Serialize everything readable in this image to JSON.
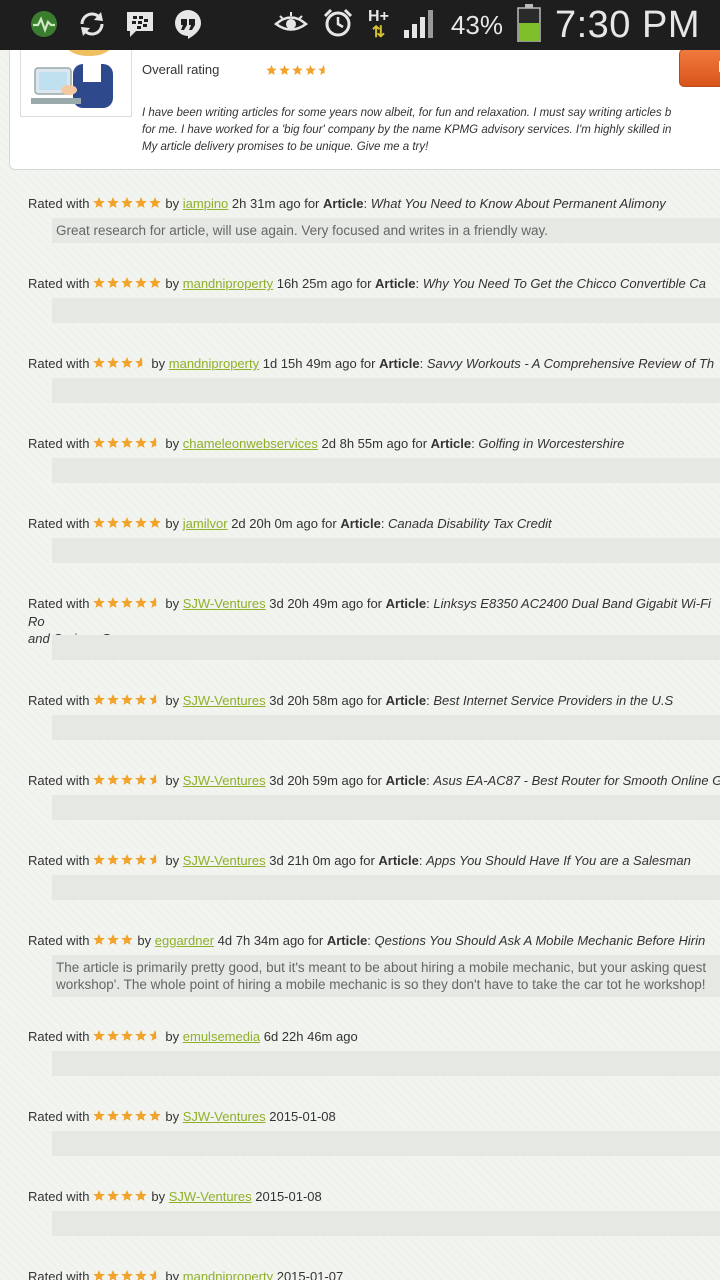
{
  "statusbar": {
    "battery": "43%",
    "time": "7:30 PM",
    "network": "H+"
  },
  "profile": {
    "overall_label": "Overall rating",
    "overall_stars": 4.5,
    "hire_label": "H",
    "bio": "I have been writing articles for some years now albeit, for fun and relaxation. I must say writing articles b\nfor me. I have worked for a 'big four' company by the name KPMG advisory services. I'm highly skilled in\nMy article delivery promises to be unique. Give me a try!"
  },
  "colors": {
    "star": "#f2a32b",
    "link": "#8fb02a",
    "hire": "#e8622a"
  },
  "entries": [
    {
      "rated": "Rated with",
      "stars": 5,
      "by": "by",
      "user": "iampino",
      "when": "2h 31m ago",
      "for": "for",
      "kw": "Article",
      "title": "What You Need to Know About Permanent Alimony",
      "title2": "",
      "comment": "Great research for article, will use again. Very focused and writes in a friendly way."
    },
    {
      "rated": "Rated with",
      "stars": 5,
      "by": "by",
      "user": "mandniproperty",
      "when": "16h 25m ago",
      "for": "for",
      "kw": "Article",
      "title": "Why You Need To Get the Chicco Convertible Ca",
      "title2": "",
      "comment": ""
    },
    {
      "rated": "Rated with",
      "stars": 3.5,
      "by": "by",
      "user": "mandniproperty",
      "when": "1d 15h 49m ago",
      "for": "for",
      "kw": "Article",
      "title": "Savvy Workouts - A Comprehensive Review of Th",
      "title2": "",
      "comment": ""
    },
    {
      "rated": "Rated with",
      "stars": 4.5,
      "by": "by",
      "user": "chameleonwebservices",
      "when": "2d 8h 55m ago",
      "for": "for",
      "kw": "Article",
      "title": "Golfing in Worcestershire",
      "title2": "",
      "comment": ""
    },
    {
      "rated": "Rated with",
      "stars": 5,
      "by": "by",
      "user": "jamilvor",
      "when": "2d 20h 0m ago",
      "for": "for",
      "kw": "Article",
      "title": "Canada Disability Tax Credit",
      "title2": "",
      "comment": ""
    },
    {
      "rated": "Rated with",
      "stars": 4.5,
      "by": "by",
      "user": "SJW-Ventures",
      "when": "3d 20h 49m ago",
      "for": "for",
      "kw": "Article",
      "title": "Linksys E8350 AC2400 Dual Band Gigabit Wi-Fi Ro",
      "title2": "and Serious Gamers",
      "comment": ""
    },
    {
      "rated": "Rated with",
      "stars": 4.5,
      "by": "by",
      "user": "SJW-Ventures",
      "when": "3d 20h 58m ago",
      "for": "for",
      "kw": "Article",
      "title": "Best Internet Service Providers in the U.S",
      "title2": "",
      "comment": ""
    },
    {
      "rated": "Rated with",
      "stars": 4.5,
      "by": "by",
      "user": "SJW-Ventures",
      "when": "3d 20h 59m ago",
      "for": "for",
      "kw": "Article",
      "title": "Asus EA-AC87 - Best Router for Smooth Online Ga",
      "title2": "",
      "comment": ""
    },
    {
      "rated": "Rated with",
      "stars": 4.5,
      "by": "by",
      "user": "SJW-Ventures",
      "when": "3d 21h 0m ago",
      "for": "for",
      "kw": "Article",
      "title": "Apps You Should Have If You are a Salesman",
      "title2": "",
      "comment": ""
    },
    {
      "rated": "Rated with",
      "stars": 3,
      "by": "by",
      "user": "eggardner",
      "when": "4d 7h 34m ago",
      "for": "for",
      "kw": "Article",
      "title": "Qestions You Should Ask A Mobile Mechanic Before Hirin",
      "title2": "",
      "comment": "The article is primarily pretty good, but it's meant to be about hiring a mobile mechanic, but your asking quest\nworkshop'. The whole point of hiring a mobile mechanic is so they don't have to take the car tot he workshop!"
    },
    {
      "rated": "Rated with",
      "stars": 4.5,
      "by": "by",
      "user": "emulsemedia",
      "when": "6d 22h 46m ago",
      "for": "",
      "kw": "",
      "title": "",
      "title2": "",
      "comment": ""
    },
    {
      "rated": "Rated with",
      "stars": 5,
      "by": "by",
      "user": "SJW-Ventures",
      "when": "2015-01-08",
      "for": "",
      "kw": "",
      "title": "",
      "title2": "",
      "comment": ""
    },
    {
      "rated": "Rated with",
      "stars": 4,
      "by": "by",
      "user": "SJW-Ventures",
      "when": "2015-01-08",
      "for": "",
      "kw": "",
      "title": "",
      "title2": "",
      "comment": ""
    },
    {
      "rated": "Rated with",
      "stars": 4.5,
      "by": "by",
      "user": "mandniproperty",
      "when": "2015-01-07",
      "for": "",
      "kw": "",
      "title": "",
      "title2": "",
      "comment": ""
    }
  ]
}
